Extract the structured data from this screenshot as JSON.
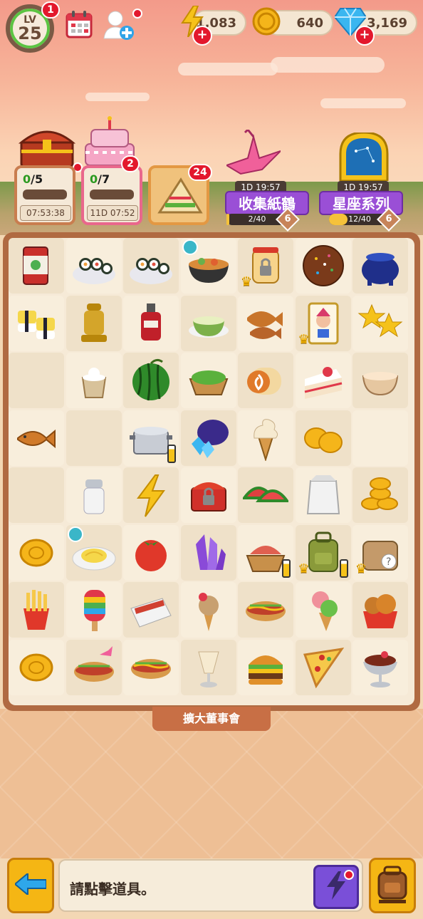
{
  "hud": {
    "level_label": "LV",
    "level": "25",
    "level_badge": "1",
    "energy": "1,083",
    "coins": "640",
    "gems": "3,169",
    "calendar_icon": "calendar-icon",
    "friends_icon": "add-friend-icon"
  },
  "orders": [
    {
      "done": "0",
      "total": "/5",
      "time": "07:53:38"
    },
    {
      "done": "0",
      "total": "/7",
      "time": "11D 07:52",
      "badge": "2"
    },
    {
      "badge": "24",
      "icon": "sandwich-icon"
    }
  ],
  "events": [
    {
      "timer": "1D 19:57",
      "title": "收集紙鶴",
      "progress": "2/40",
      "progress_value": 0.05,
      "level": "6"
    },
    {
      "timer": "1D 19:57",
      "title": "星座系列",
      "progress": "12/40",
      "progress_value": 0.3,
      "level": "6"
    }
  ],
  "board": {
    "cols": 7,
    "rows": 8,
    "items": [
      [
        "soup-can",
        "sushi-roll-plate",
        "sushi-roll-plate",
        "noodle-bowl",
        "locked-jar",
        "chocolate-donut",
        "cauldron"
      ],
      [
        "tamago-sushi",
        "pepper-mill",
        "red-sauce-bottle",
        "soup-bowl",
        "taiyaki-pair",
        "joker-card",
        "gold-stars"
      ],
      [
        "",
        "flour-pot",
        "watermelon",
        "salad-basket",
        "cake-roll",
        "strawberry-cake",
        "mixing-bowl"
      ],
      [
        "taiyaki",
        "",
        "cooking-pot",
        "gem-bag",
        "ice-cream-cone",
        "gold-coins-small",
        ""
      ],
      [
        "",
        "salt-shaker",
        "lightning-bolt",
        "locked-chest",
        "watermelon-slices",
        "paper-bag",
        "gold-coin-stack"
      ],
      [
        "gold-coin",
        "pasta-plate",
        "tomato",
        "purple-crystal",
        "bread-basket",
        "backpack",
        "mystery-bag"
      ],
      [
        "french-fries",
        "rainbow-popsicle",
        "hotdog-tray",
        "ice-cream-cherry",
        "hotdog",
        "ice-cream-green",
        "fried-chicken"
      ],
      [
        "gold-coin",
        "hotdog-crane",
        "hotdog",
        "parfait",
        "burger",
        "pizza-slice",
        "sundae"
      ]
    ]
  },
  "expand_label": "擴大董事會",
  "bottom": {
    "message": "請點擊道具。",
    "back_icon": "back-arrow-icon",
    "energy_icon": "lightning-icon",
    "bag_icon": "backpack-icon"
  }
}
